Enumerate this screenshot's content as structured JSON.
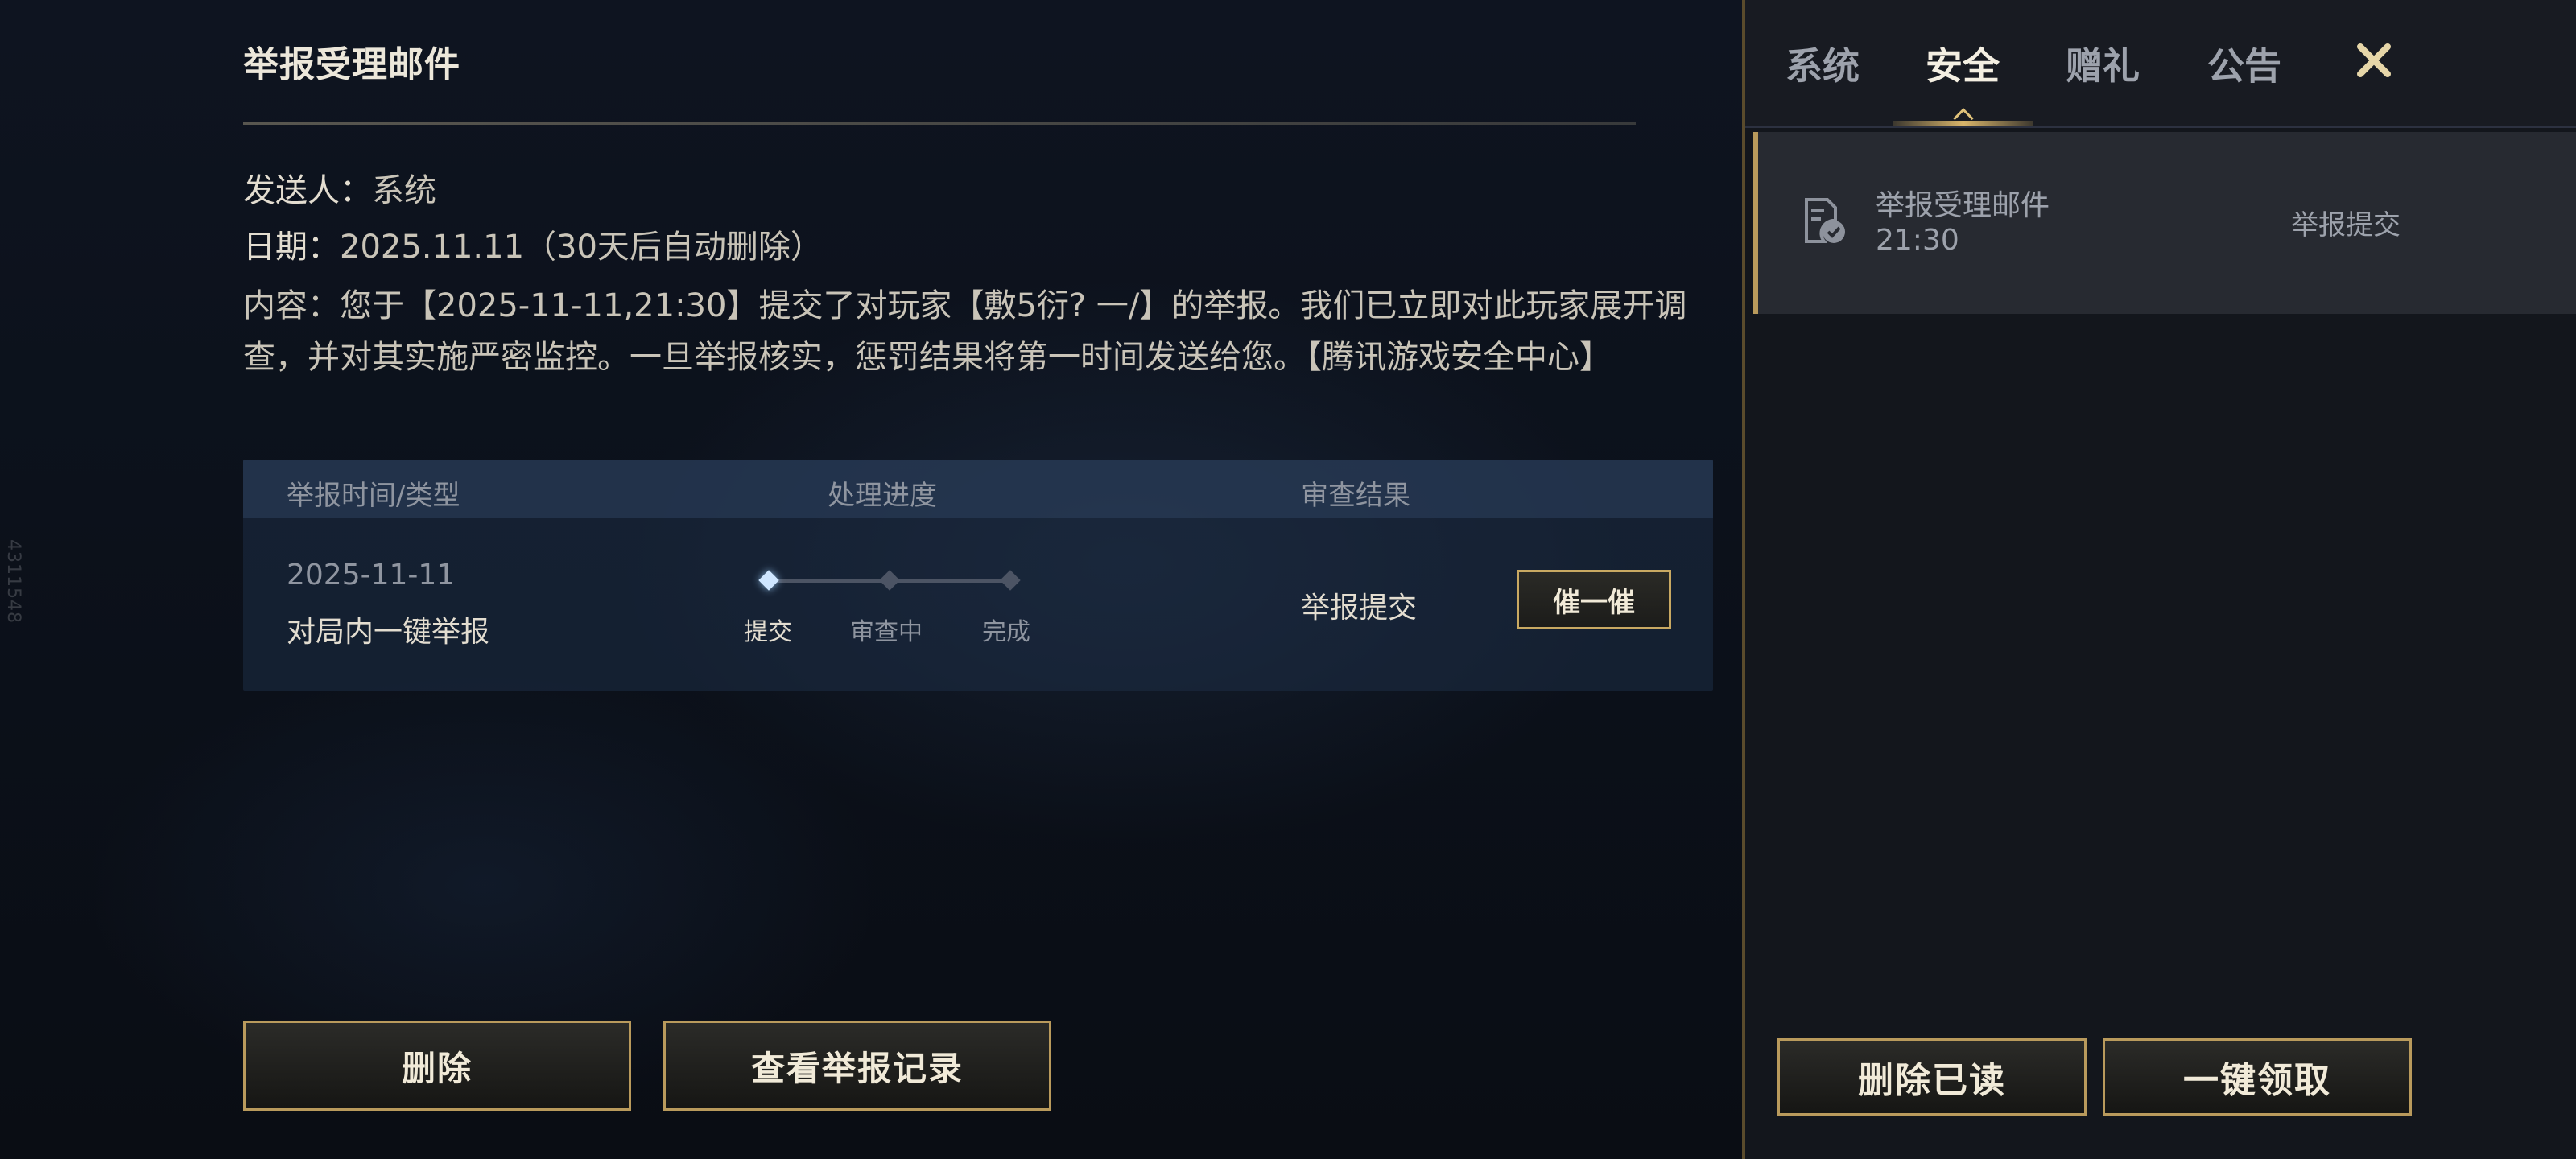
{
  "side_id": "4311548",
  "detail": {
    "title": "举报受理邮件",
    "sender_label": "发送人：",
    "sender_value": "系统",
    "date_label": "日期：",
    "date_value": "2025.11.11（30天后自动删除）",
    "content_label": "内容：",
    "content_text": "您于【2025-11-11,21:30】提交了对玩家【敷5衍? 一/】的举报。我们已立即对此玩家展开调查，并对其实施严密监控。一旦举报核实，惩罚结果将第一时间发送给您。【腾讯游戏安全中心】",
    "table": {
      "headers": {
        "time_type": "举报时间/类型",
        "progress": "处理进度",
        "result": "审查结果"
      },
      "row": {
        "date": "2025-11-11",
        "type": "对局内一键举报",
        "steps": [
          "提交",
          "审查中",
          "完成"
        ],
        "current_step": 1,
        "result": "举报提交",
        "urge_label": "催一催"
      }
    },
    "delete_label": "删除",
    "records_label": "查看举报记录"
  },
  "panel": {
    "tabs": [
      {
        "label": "系统"
      },
      {
        "label": "安全"
      },
      {
        "label": "赠礼"
      },
      {
        "label": "公告"
      }
    ],
    "active_tab": "安全",
    "mail_item": {
      "title": "举报受理邮件",
      "time": "21:30",
      "status": "举报提交",
      "icon": "mail-check-icon"
    },
    "delete_read_label": "删除已读",
    "claim_all_label": "一键领取"
  },
  "colors": {
    "accent_gold": "#c9a962",
    "active_step": "#cfe6ff"
  }
}
